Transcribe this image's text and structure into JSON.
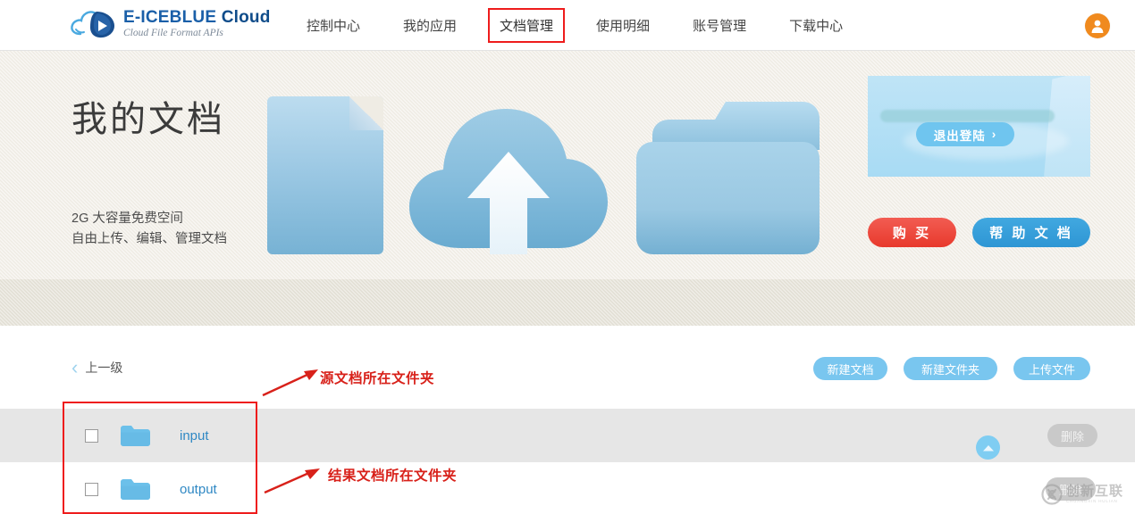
{
  "header": {
    "logo": {
      "title_main": "E-ICEBLUE",
      "title_accent": "Cloud",
      "subtitle": "Cloud File Format APIs",
      "icon": "cloud-logo-icon"
    },
    "nav": [
      {
        "label": "控制中心",
        "active": false
      },
      {
        "label": "我的应用",
        "active": false
      },
      {
        "label": "文档管理",
        "active": true
      },
      {
        "label": "使用明细",
        "active": false
      },
      {
        "label": "账号管理",
        "active": false
      },
      {
        "label": "下载中心",
        "active": false
      }
    ],
    "avatar_icon": "user-avatar-icon"
  },
  "hero": {
    "title": "我的文档",
    "subtitle_line1": "2G 大容量免费空间",
    "subtitle_line2": "自由上传、编辑、管理文档",
    "illustrations": [
      "document-icon",
      "cloud-upload-icon",
      "folder-icon"
    ],
    "promo": {
      "logout_label": "退出登陆",
      "logout_chevron": "›"
    },
    "buy_label": "购 买",
    "help_label": "帮 助 文 档"
  },
  "filemanager": {
    "breadcrumb": {
      "chevron": "‹",
      "label": "上一级"
    },
    "toolbar": [
      {
        "label": "新建文档"
      },
      {
        "label": "新建文件夹"
      },
      {
        "label": "上传文件"
      }
    ],
    "rows": [
      {
        "name": "input",
        "type": "folder",
        "checked": false,
        "delete_label": "删除",
        "selected": true
      },
      {
        "name": "output",
        "type": "folder",
        "checked": false,
        "delete_label": "删除",
        "selected": false
      }
    ],
    "scroll_top_icon": "arrow-up-icon"
  },
  "annotations": {
    "box_label": "red-highlight-box",
    "note_source": "源文档所在文件夹",
    "note_result": "结果文档所在文件夹"
  },
  "watermark": {
    "cn": "创新互联",
    "en": "CHUANGXIN HULIAN"
  },
  "colors": {
    "accent_blue": "#2f88c4",
    "button_blue": "#79c6ef",
    "buy_red": "#e8392c",
    "annotation_red": "#d8211a",
    "avatar_orange": "#f08a1e",
    "hero_bg": "#efece4"
  }
}
